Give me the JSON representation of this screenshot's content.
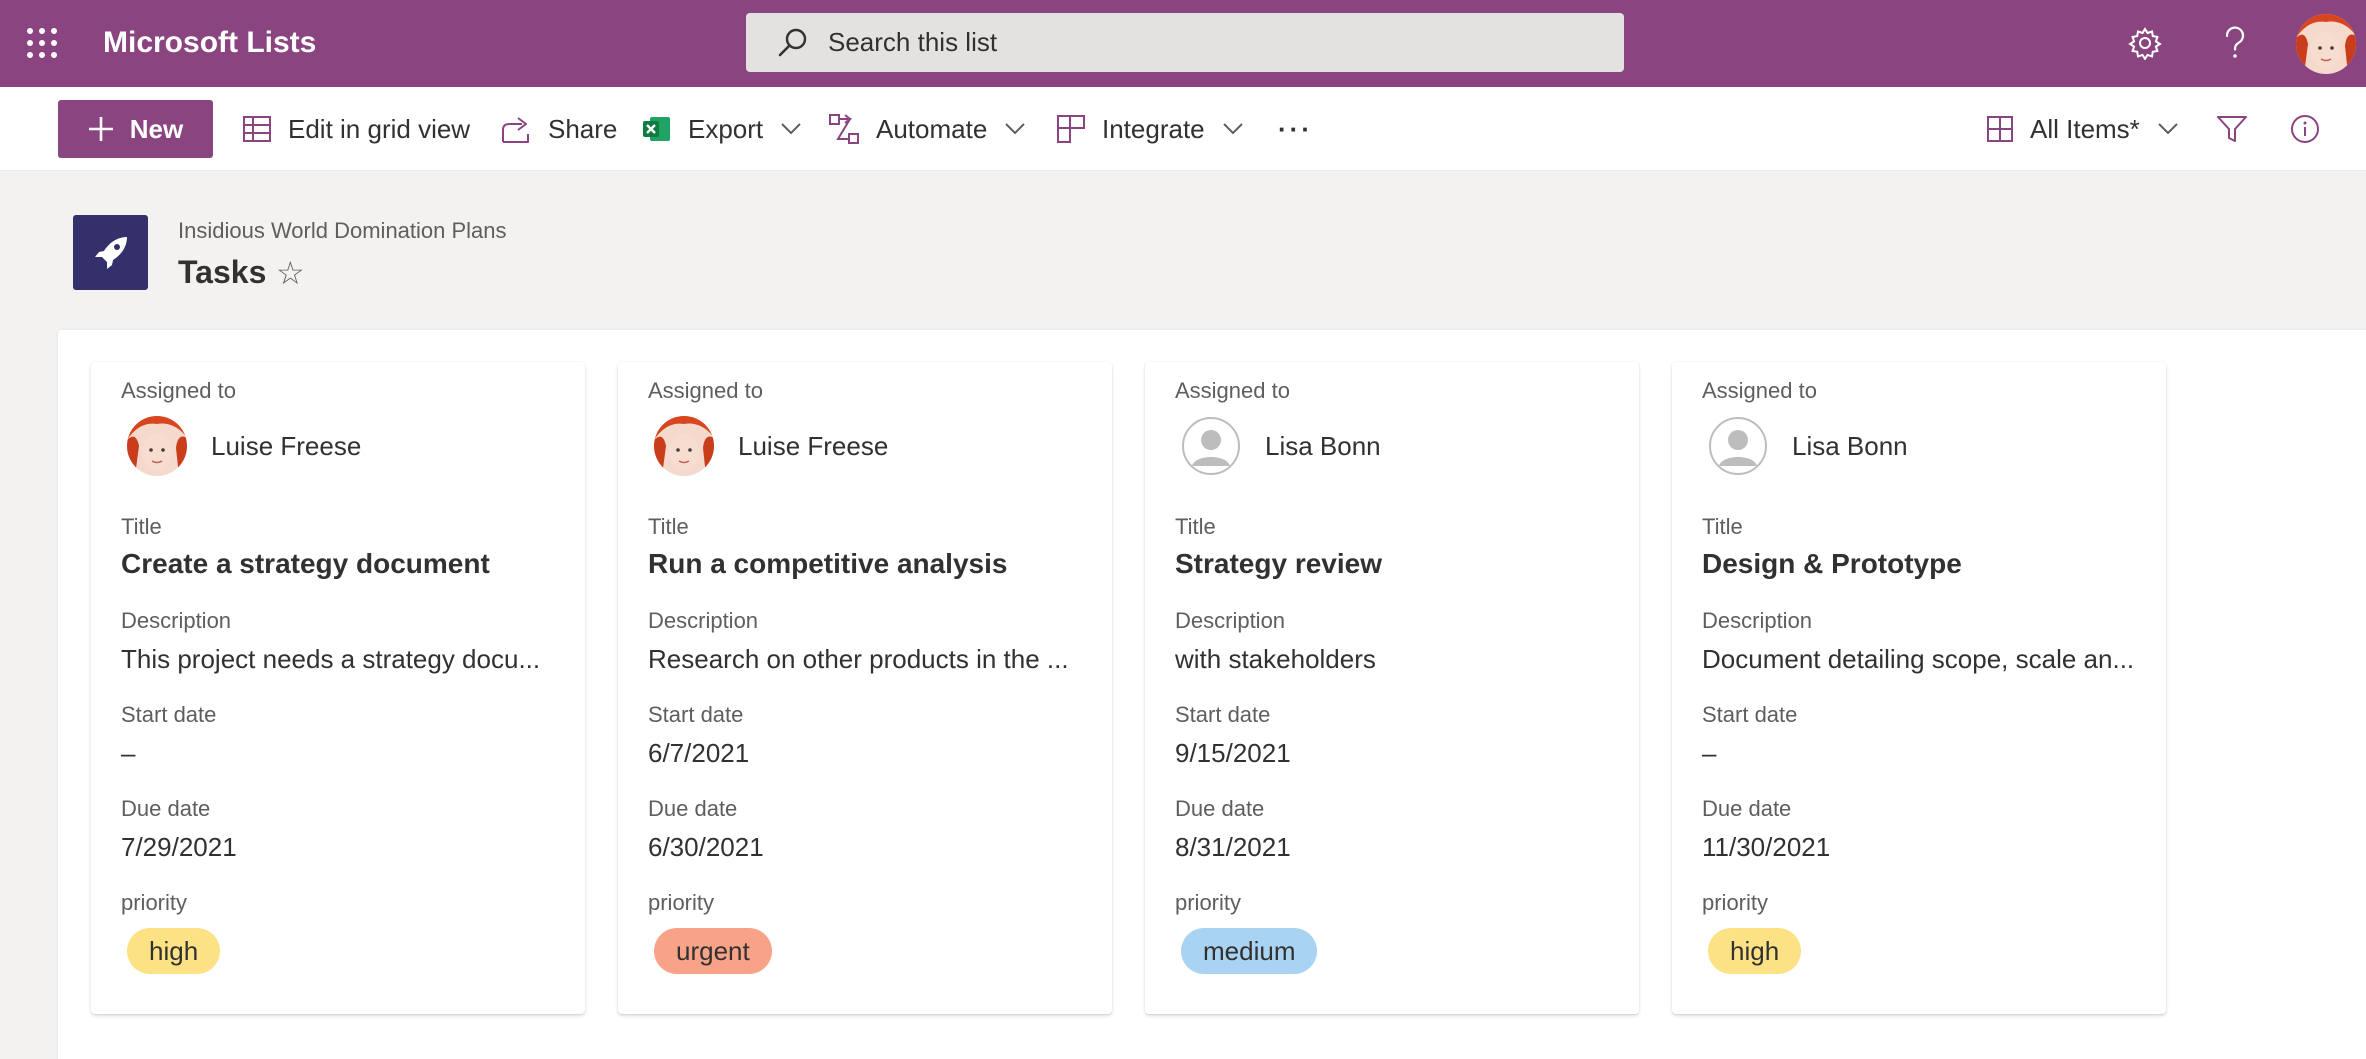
{
  "suitebar": {
    "app_title": "Microsoft Lists",
    "search_placeholder": "Search this list",
    "icons": [
      "app-launcher-icon",
      "search-icon",
      "gear-icon",
      "help-icon",
      "avatar"
    ]
  },
  "command_bar": {
    "new_label": "New",
    "edit_grid_label": "Edit in grid view",
    "share_label": "Share",
    "export_label": "Export",
    "automate_label": "Automate",
    "integrate_label": "Integrate",
    "more_label": "···",
    "view_label": "All Items*"
  },
  "header": {
    "site_name": "Insidious World Domination Plans",
    "list_name": "Tasks",
    "star": "☆"
  },
  "field_labels": {
    "assigned_to": "Assigned to",
    "title": "Title",
    "description": "Description",
    "start_date": "Start date",
    "due_date": "Due date",
    "priority": "priority"
  },
  "cards": [
    {
      "assigned": "Luise Freese",
      "title": "Create a strategy document",
      "description": "This project needs a strategy docu...",
      "start": "–",
      "due": "7/29/2021",
      "priority": "high",
      "priority_color": "#fce285"
    },
    {
      "assigned": "Luise Freese",
      "title": "Run a competitive analysis",
      "description": "Research on other products in the ...",
      "start": "6/7/2021",
      "due": "6/30/2021",
      "priority": "urgent",
      "priority_color": "#f8a387"
    },
    {
      "assigned": "Lisa Bonn",
      "title": "Strategy review",
      "description": "with stakeholders",
      "start": "9/15/2021",
      "due": "8/31/2021",
      "priority": "medium",
      "priority_color": "#a9d3f2"
    },
    {
      "assigned": "Lisa Bonn",
      "title": "Design & Prototype",
      "description": "Document detailing scope, scale an...",
      "start": "–",
      "due": "11/30/2021",
      "priority": "high",
      "priority_color": "#fce285"
    }
  ],
  "colors": {
    "brand": "#8a4580",
    "list_icon_bg": "#33306b"
  }
}
